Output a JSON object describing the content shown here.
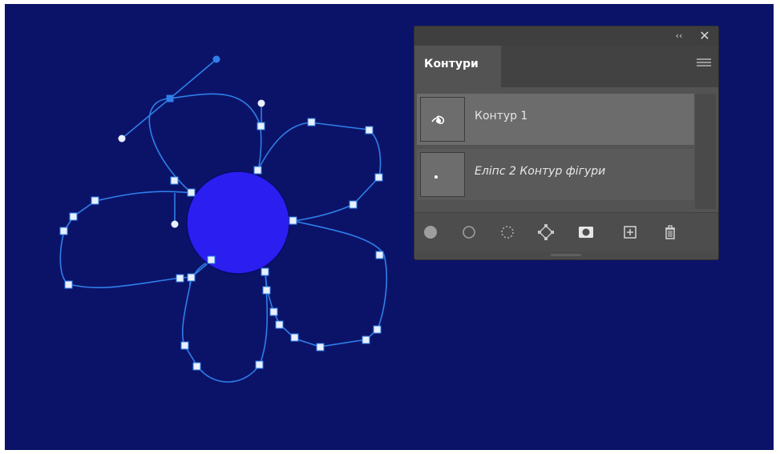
{
  "panel": {
    "tab_label": "Контури",
    "collapse_icon": "double-chevron-left",
    "close_icon": "close-x",
    "menu_icon": "hamburger-menu",
    "paths": [
      {
        "label": "Контур 1",
        "selected": true
      },
      {
        "label": "Еліпс 2 Контур фігури",
        "selected": false
      }
    ],
    "footer_buttons": [
      "fill-path-icon",
      "stroke-path-icon",
      "load-path-as-selection-icon",
      "make-work-path-icon",
      "add-mask-icon",
      "create-new-path-icon",
      "delete-path-icon"
    ]
  },
  "colors": {
    "canvas_background": "#0b1369",
    "circle_fill": "#2a1ff0",
    "path_stroke": "#2f7fe8",
    "anchor_fill": "#e8f0ff",
    "panel_background": "#535353"
  }
}
